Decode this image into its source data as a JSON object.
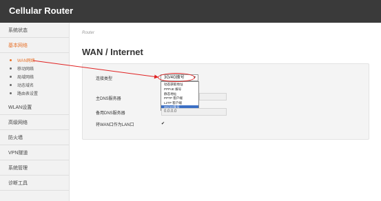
{
  "header": {
    "brand": "Cellular Router"
  },
  "sidebar": {
    "items": [
      {
        "label": "系统状态"
      },
      {
        "label": "基本网络"
      },
      {
        "label": "WLAN设置"
      },
      {
        "label": "高级网络"
      },
      {
        "label": "防火墙"
      },
      {
        "label": "VPN隧道"
      },
      {
        "label": "系统管理"
      },
      {
        "label": "诊断工具"
      }
    ],
    "subitems": [
      {
        "label": "WAN网络"
      },
      {
        "label": "移动网络"
      },
      {
        "label": "局域网络"
      },
      {
        "label": "动态域名"
      },
      {
        "label": "路由表设置"
      }
    ]
  },
  "main": {
    "breadcrumb": "Router",
    "title": "WAN / Internet",
    "connection_type_label": "连接类型",
    "connection_type_value": "3G/4G拨号",
    "dropdown_options": [
      "动态获取地址",
      "PPPoE 拨号",
      "静态地址",
      "PPTP 客户端",
      "L2TP 客户端",
      "3G/4G拨号"
    ],
    "primary_dns_label": "主DNS服务器",
    "primary_dns_value": "",
    "secondary_dns_label": "备用DNS服务器",
    "secondary_dns_value": "0.0.0.0",
    "wan_as_lan_label": "将WAN口作为LAN口",
    "wan_as_lan_checked": "✔"
  },
  "colors": {
    "accent": "#e8722a",
    "topbar": "#3a3a3a",
    "annotation": "#e02020",
    "selected_option": "#3b6fc4"
  }
}
